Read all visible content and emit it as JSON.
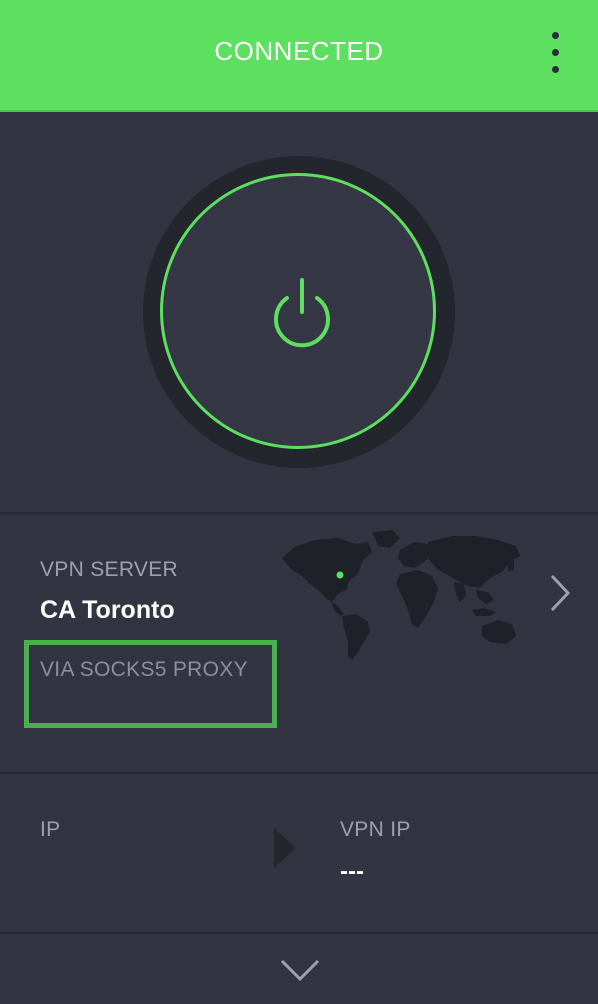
{
  "header": {
    "status": "CONNECTED",
    "menu_icon": "more-vertical-icon",
    "color": "#5ddf5f"
  },
  "power": {
    "icon": "power-icon",
    "state": "connected",
    "ring_color": "#5ddf5f"
  },
  "server": {
    "label": "VPN SERVER",
    "name": "CA Toronto",
    "proxy_label": "VIA SOCKS5 PROXY",
    "map_icon": "world-map-icon",
    "chevron_icon": "chevron-right-icon"
  },
  "ip": {
    "label": "IP",
    "value": "",
    "vpn_label": "VPN IP",
    "vpn_value": "---"
  },
  "footer": {
    "expand_icon": "chevron-down-icon"
  },
  "colors": {
    "background": "#323541",
    "accent": "#5ddf5f",
    "highlight": "#4caf50"
  }
}
